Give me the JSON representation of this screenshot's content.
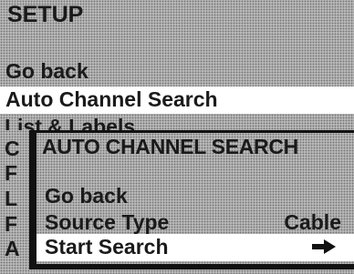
{
  "setup_menu": {
    "title": "SETUP",
    "go_back": "Go back",
    "selected_item": "Auto Channel Search",
    "partial_items": [
      "List & Labels",
      "C",
      "F",
      "L",
      "F",
      "A"
    ]
  },
  "auto_channel_search_menu": {
    "title": "AUTO CHANNEL SEARCH",
    "go_back": "Go back",
    "source_type": {
      "label": "Source Type",
      "value": "Cable"
    },
    "start_search": {
      "label": "Start Search",
      "icon": "right-arrow-icon"
    }
  },
  "colors": {
    "panel": "#b9b9b9",
    "highlight": "#ffffff",
    "text": "#1a1a1a",
    "border": "#111111"
  }
}
